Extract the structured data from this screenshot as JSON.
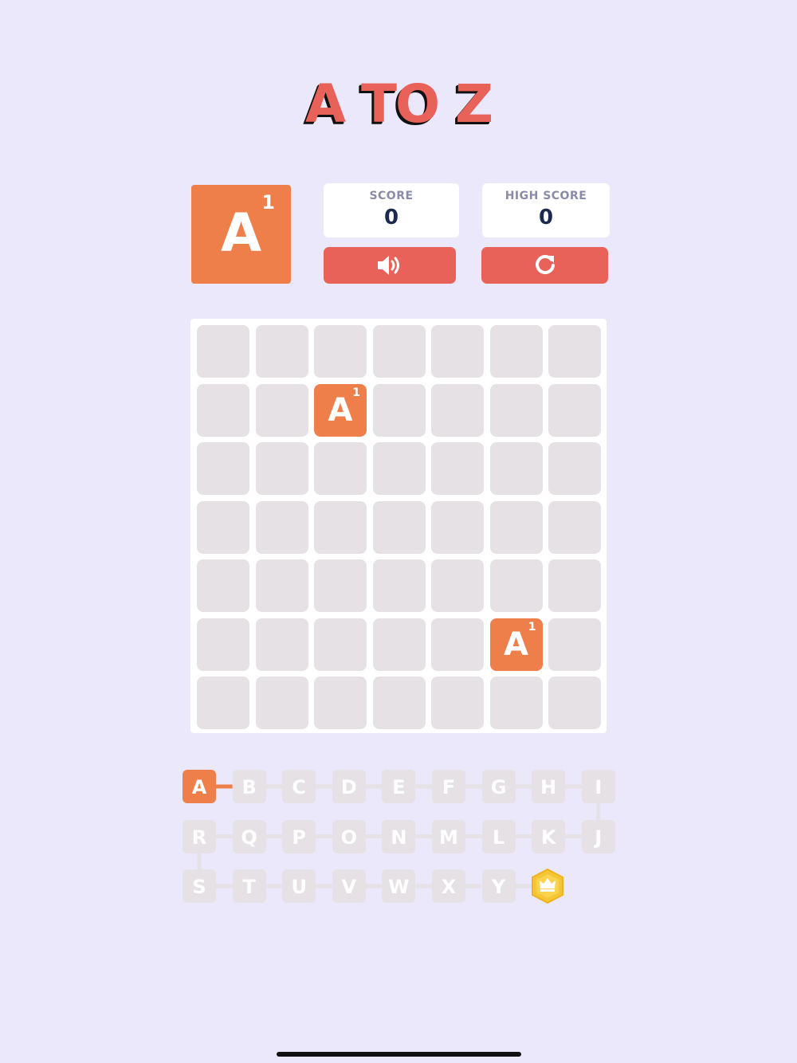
{
  "title": "A TO Z",
  "next_tile": {
    "letter": "A",
    "value": "1"
  },
  "score": {
    "label": "SCORE",
    "value": "0"
  },
  "high_score": {
    "label": "HIGH SCORE",
    "value": "0"
  },
  "buttons": {
    "sound_icon": "speaker-icon",
    "restart_icon": "restart-icon"
  },
  "board": {
    "rows": 7,
    "cols": 7,
    "tiles": [
      {
        "row": 1,
        "col": 2,
        "letter": "A",
        "value": "1"
      },
      {
        "row": 5,
        "col": 5,
        "letter": "A",
        "value": "1"
      }
    ]
  },
  "alphabet_track": {
    "rows": [
      [
        "A",
        "B",
        "C",
        "D",
        "E",
        "F",
        "G",
        "H",
        "I"
      ],
      [
        "R",
        "Q",
        "P",
        "O",
        "N",
        "M",
        "L",
        "K",
        "J"
      ],
      [
        "S",
        "T",
        "U",
        "V",
        "W",
        "X",
        "Y"
      ]
    ],
    "current": "A",
    "goal_icon": "crown-badge-icon"
  },
  "colors": {
    "background": "#eae8fa",
    "accent": "#e8625a",
    "tile": "#ef7f4a",
    "empty_cell": "#e6e1e4",
    "badge": "#f6c535"
  }
}
